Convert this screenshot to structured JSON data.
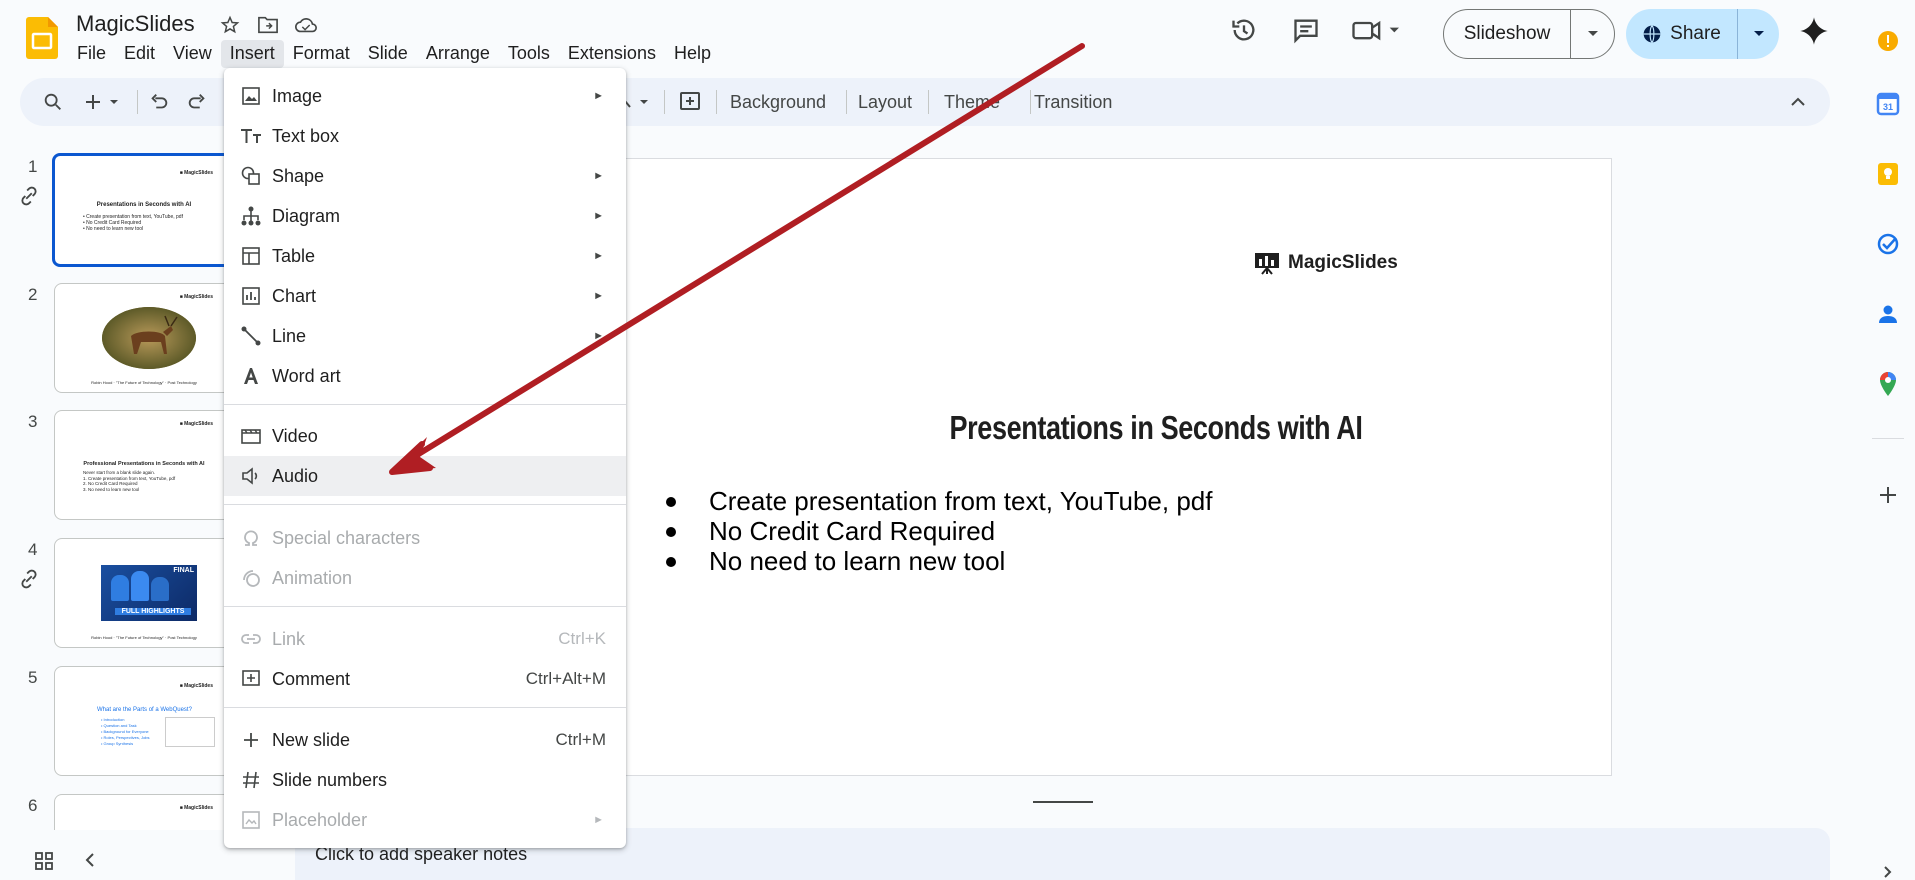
{
  "app": {
    "title": "MagicSlides",
    "brand_color": "#fbbc04",
    "accent": "#0b57d0"
  },
  "menubar": [
    "File",
    "Edit",
    "View",
    "Insert",
    "Format",
    "Slide",
    "Arrange",
    "Tools",
    "Extensions",
    "Help"
  ],
  "header": {
    "slideshow_label": "Slideshow",
    "share_label": "Share"
  },
  "toolbar": {
    "background_label": "Background",
    "layout_label": "Layout",
    "theme_label": "Theme",
    "transition_label": "Transition"
  },
  "filmstrip": {
    "slide_numbers": [
      "1",
      "2",
      "3",
      "4",
      "5",
      "6"
    ],
    "thumb1_title": "Presentations in Seconds with AI",
    "thumb3_title": "Professional Presentations in Seconds with AI",
    "thumb5_title": "What are the Parts of a WebQuest?",
    "thumb4_caption": "FULL HIGHLIGHTS"
  },
  "slide": {
    "brand": "MagicSlides",
    "title": "Presentations in Seconds with AI",
    "bullets": [
      "Create presentation from text, YouTube, pdf",
      "No Credit Card Required",
      "No need to learn new tool"
    ]
  },
  "notes": {
    "placeholder": "Click to add speaker notes"
  },
  "insert_menu": {
    "items": [
      {
        "label": "Image",
        "icon": "image-icon",
        "submenu": true
      },
      {
        "label": "Text box",
        "icon": "text-box-icon"
      },
      {
        "label": "Shape",
        "icon": "shape-icon",
        "submenu": true
      },
      {
        "label": "Diagram",
        "icon": "diagram-icon",
        "submenu": true
      },
      {
        "label": "Table",
        "icon": "table-icon",
        "submenu": true
      },
      {
        "label": "Chart",
        "icon": "chart-icon",
        "submenu": true
      },
      {
        "label": "Line",
        "icon": "line-icon",
        "submenu": true
      },
      {
        "label": "Word art",
        "icon": "word-art-icon"
      },
      {
        "label": "Video",
        "icon": "video-icon"
      },
      {
        "label": "Audio",
        "icon": "audio-icon",
        "highlighted": true
      },
      {
        "label": "Special characters",
        "icon": "omega-icon",
        "disabled": true
      },
      {
        "label": "Animation",
        "icon": "animation-icon",
        "disabled": true
      },
      {
        "label": "Link",
        "icon": "link-icon",
        "shortcut": "Ctrl+K",
        "disabled": true
      },
      {
        "label": "Comment",
        "icon": "comment-icon",
        "shortcut": "Ctrl+Alt+M"
      },
      {
        "label": "New slide",
        "icon": "plus-icon",
        "shortcut": "Ctrl+M"
      },
      {
        "label": "Slide numbers",
        "icon": "hash-icon"
      },
      {
        "label": "Placeholder",
        "icon": "placeholder-icon",
        "submenu": true,
        "disabled": true
      }
    ]
  }
}
